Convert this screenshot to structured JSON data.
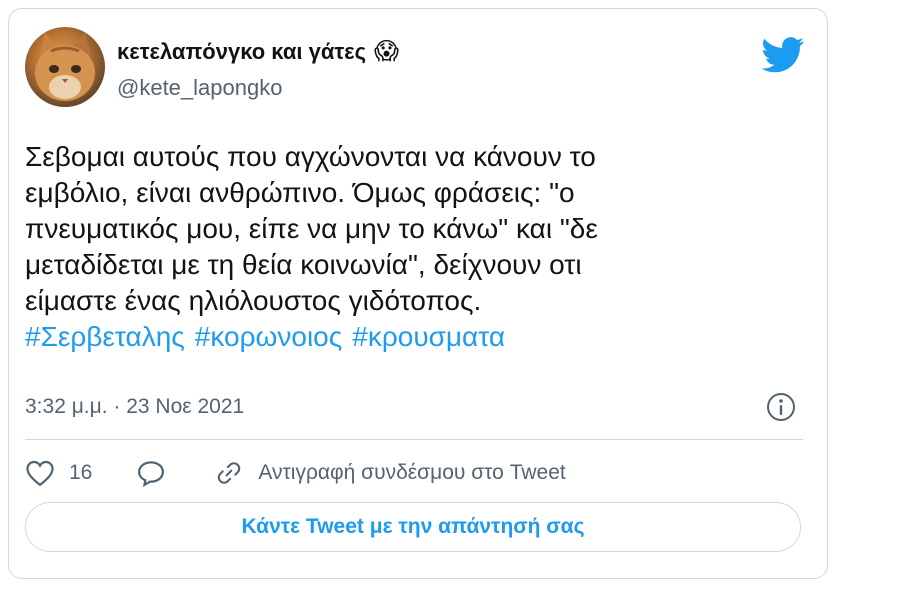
{
  "user": {
    "display_name": "κετελαπόνγκο και γάτες",
    "emoji": "😱",
    "handle": "@kete_lapongko",
    "avatar_icon": "cat-photo-avatar"
  },
  "tweet": {
    "text_lines": [
      "Σεβομαι αυτούς που αγχώνονται να κάνουν το",
      "εμβόλιο, είναι ανθρώπινο. Όμως φράσεις: \"ο",
      "πνευματικός μου, είπε να μην το κάνω\" και \"δε",
      "μεταδίδεται με τη θεία κοινωνία\", δείχνουν οτι",
      "είμαστε ένας ηλιόλουστος γιδότοπος."
    ],
    "hashtags": [
      "#Σερβεταλης",
      "#κορωνοιος",
      "#κρουσματα"
    ],
    "timestamp": "3:32 μ.μ. · 23 Νοε 2021"
  },
  "actions": {
    "like_count": "16",
    "copy_link_label": "Αντιγραφή συνδέσμου στο Tweet",
    "reply_button_label": "Κάντε Tweet με την απάντησή σας"
  },
  "colors": {
    "accent": "#1d9bf0",
    "text": "#0f1419",
    "secondary": "#536471",
    "border": "#cfd9de"
  },
  "icons": {
    "brand": "twitter-bird-icon",
    "info": "info-icon",
    "like": "heart-icon",
    "reply": "speech-bubble-icon",
    "copy": "link-icon"
  }
}
